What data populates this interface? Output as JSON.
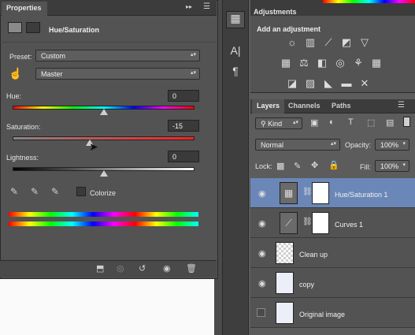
{
  "properties": {
    "tab_label": "Properties",
    "collapse_icon": "double-chevron-right",
    "menu_icon": "menu-lines",
    "adjustment_title": "Hue/Saturation",
    "preset_label": "Preset:",
    "preset_value": "Custom",
    "channel_value": "Master",
    "hue_label": "Hue:",
    "hue_value": "0",
    "saturation_label": "Saturation:",
    "saturation_value": "-15",
    "lightness_label": "Lightness:",
    "lightness_value": "0",
    "colorize_label": "Colorize"
  },
  "adjustments": {
    "tab_label": "Adjustments",
    "add_label": "Add an adjustment"
  },
  "layers_panel": {
    "tabs": [
      "Layers",
      "Channels",
      "Paths"
    ],
    "filter_kind": "Kind",
    "blend_mode": "Normal",
    "opacity_label": "Opacity:",
    "opacity_value": "100%",
    "lock_label": "Lock:",
    "fill_label": "Fill:",
    "fill_value": "100%",
    "layers": [
      {
        "name": "Hue/Saturation 1",
        "selected": true,
        "visible": true
      },
      {
        "name": "Curves 1",
        "selected": false,
        "visible": true
      },
      {
        "name": "Clean up",
        "selected": false,
        "visible": true
      },
      {
        "name": "copy",
        "selected": false,
        "visible": true
      },
      {
        "name": "Original image",
        "selected": false,
        "visible": false
      }
    ]
  },
  "colors": {
    "panel": "#535353",
    "tabbar": "#3c3c3c",
    "selected_layer": "#6a87b8"
  }
}
